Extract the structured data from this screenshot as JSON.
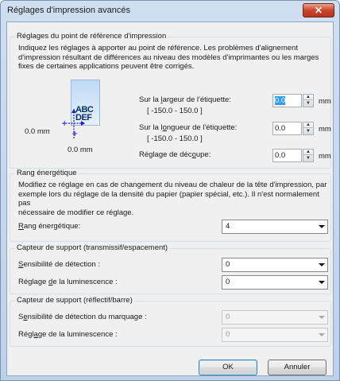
{
  "window": {
    "title": "Réglages d'impression avancés",
    "close_glyph": "✕"
  },
  "ref_point": {
    "legend": "Réglages du point de référence d'impression",
    "description_lines": [
      "Indiquez les réglages à apporter au point de référence. Les problèmes d'alignement",
      "d'impression résultant de différences au niveau des modèles d'imprimantes ou les marges",
      "fixes de certaines applications peuvent être corrigés."
    ],
    "illustration_text": [
      "ABC",
      "DEF"
    ],
    "origin_label_x": "0.0 mm",
    "origin_label_y": "0.0 mm",
    "width_label_pre": "Sur la ",
    "width_label_ul": "l",
    "width_label_post": "argeur de l'étiquette:",
    "width_range": "[ -150.0 - 150.0 ]",
    "width_value": "0.0",
    "length_label_pre": "Sur la l",
    "length_label_ul": "o",
    "length_label_post": "ngueur de l'étiquette:",
    "length_range": "[ -150.0 - 150.0 ]",
    "length_value": "0.0",
    "cut_label_pre": "Réglage de déc",
    "cut_label_ul": "o",
    "cut_label_post": "upe:",
    "cut_value": "0.0",
    "unit": "mm"
  },
  "energy": {
    "legend": "Rang énergétique",
    "description_lines": [
      "Modifiez ce réglage en cas de changement du niveau de chaleur de la tête d'impression, par",
      "exemple lors du réglage de la densité du papier (papier spécial, etc.). Il n'est normalement pas",
      "nécessaire de modifier ce réglage."
    ],
    "label_ul": "R",
    "label_rest": "ang énergétique:",
    "value": "4"
  },
  "sensor_transmissive": {
    "legend": "Capteur de support (transmissif/espacement)",
    "sensitivity_ul": "S",
    "sensitivity_rest": "ensibilité de détection :",
    "sensitivity_value": "0",
    "luminescence_pre": "Réglage ",
    "luminescence_ul": "d",
    "luminescence_post": "e la luminescence :",
    "luminescence_value": "0"
  },
  "sensor_reflective": {
    "legend": "Capteur de support (réflectif/barre)",
    "sensitivity_pre": "S",
    "sensitivity_ul": "e",
    "sensitivity_post": "nsibilité de détection du marquage :",
    "sensitivity_value": "0",
    "luminescence_pre": "Régl",
    "luminescence_ul": "a",
    "luminescence_post": "ge de la luminescence :",
    "luminescence_value": "0"
  },
  "buttons": {
    "ok": "OK",
    "cancel": "Annuler"
  }
}
